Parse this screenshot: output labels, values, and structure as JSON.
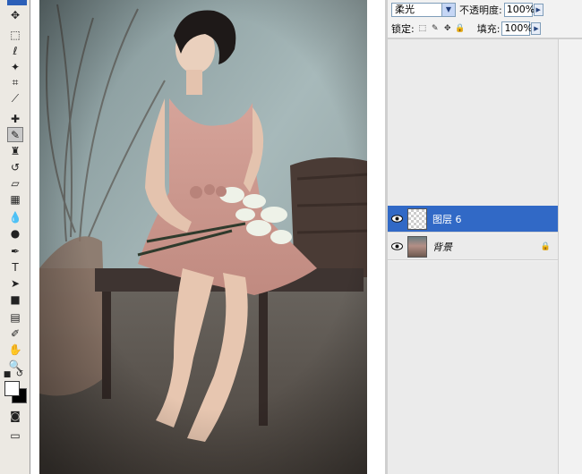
{
  "toolbar": {
    "tools": [
      {
        "name": "move-tool-icon",
        "glyph": "✥",
        "selected": false
      },
      {
        "name": "marquee-tool-icon",
        "glyph": "⬚",
        "selected": false
      },
      {
        "name": "lasso-tool-icon",
        "glyph": "ℓ",
        "selected": false
      },
      {
        "name": "magic-wand-tool-icon",
        "glyph": "✦",
        "selected": false
      },
      {
        "name": "crop-tool-icon",
        "glyph": "⌗",
        "selected": false
      },
      {
        "name": "slice-tool-icon",
        "glyph": "⟋",
        "selected": false
      },
      {
        "name": "healing-brush-tool-icon",
        "glyph": "✚",
        "selected": false
      },
      {
        "name": "brush-tool-icon",
        "glyph": "✎",
        "selected": true
      },
      {
        "name": "clone-stamp-tool-icon",
        "glyph": "♜",
        "selected": false
      },
      {
        "name": "history-brush-tool-icon",
        "glyph": "↺",
        "selected": false
      },
      {
        "name": "eraser-tool-icon",
        "glyph": "▱",
        "selected": false
      },
      {
        "name": "gradient-tool-icon",
        "glyph": "▦",
        "selected": false
      },
      {
        "name": "blur-tool-icon",
        "glyph": "💧",
        "selected": false
      },
      {
        "name": "dodge-tool-icon",
        "glyph": "●",
        "selected": false
      },
      {
        "name": "pen-tool-icon",
        "glyph": "✒",
        "selected": false
      },
      {
        "name": "type-tool-icon",
        "glyph": "T",
        "selected": false
      },
      {
        "name": "path-selection-tool-icon",
        "glyph": "➤",
        "selected": false
      },
      {
        "name": "shape-tool-icon",
        "glyph": "■",
        "selected": false
      },
      {
        "name": "notes-tool-icon",
        "glyph": "▤",
        "selected": false
      },
      {
        "name": "eyedropper-tool-icon",
        "glyph": "✐",
        "selected": false
      },
      {
        "name": "hand-tool-icon",
        "glyph": "✋",
        "selected": false
      },
      {
        "name": "zoom-tool-icon",
        "glyph": "🔍",
        "selected": false
      },
      {
        "name": "quick-mask-icon",
        "glyph": "◙",
        "selected": false
      },
      {
        "name": "screen-mode-icon",
        "glyph": "▭",
        "selected": false
      }
    ],
    "foreground_color": "#ffffff",
    "background_color": "#000000"
  },
  "layers_panel": {
    "blend_mode": "柔光",
    "opacity_label": "不透明度:",
    "opacity_value": "100%",
    "lock_label": "锁定:",
    "fill_label": "填充:",
    "fill_value": "100%",
    "layers": [
      {
        "name": "图层 6",
        "active": true,
        "thumb": "transparent",
        "locked": false
      },
      {
        "name": "背景",
        "active": false,
        "thumb": "photo",
        "locked": true
      }
    ],
    "accent_color": "#3169c6"
  }
}
